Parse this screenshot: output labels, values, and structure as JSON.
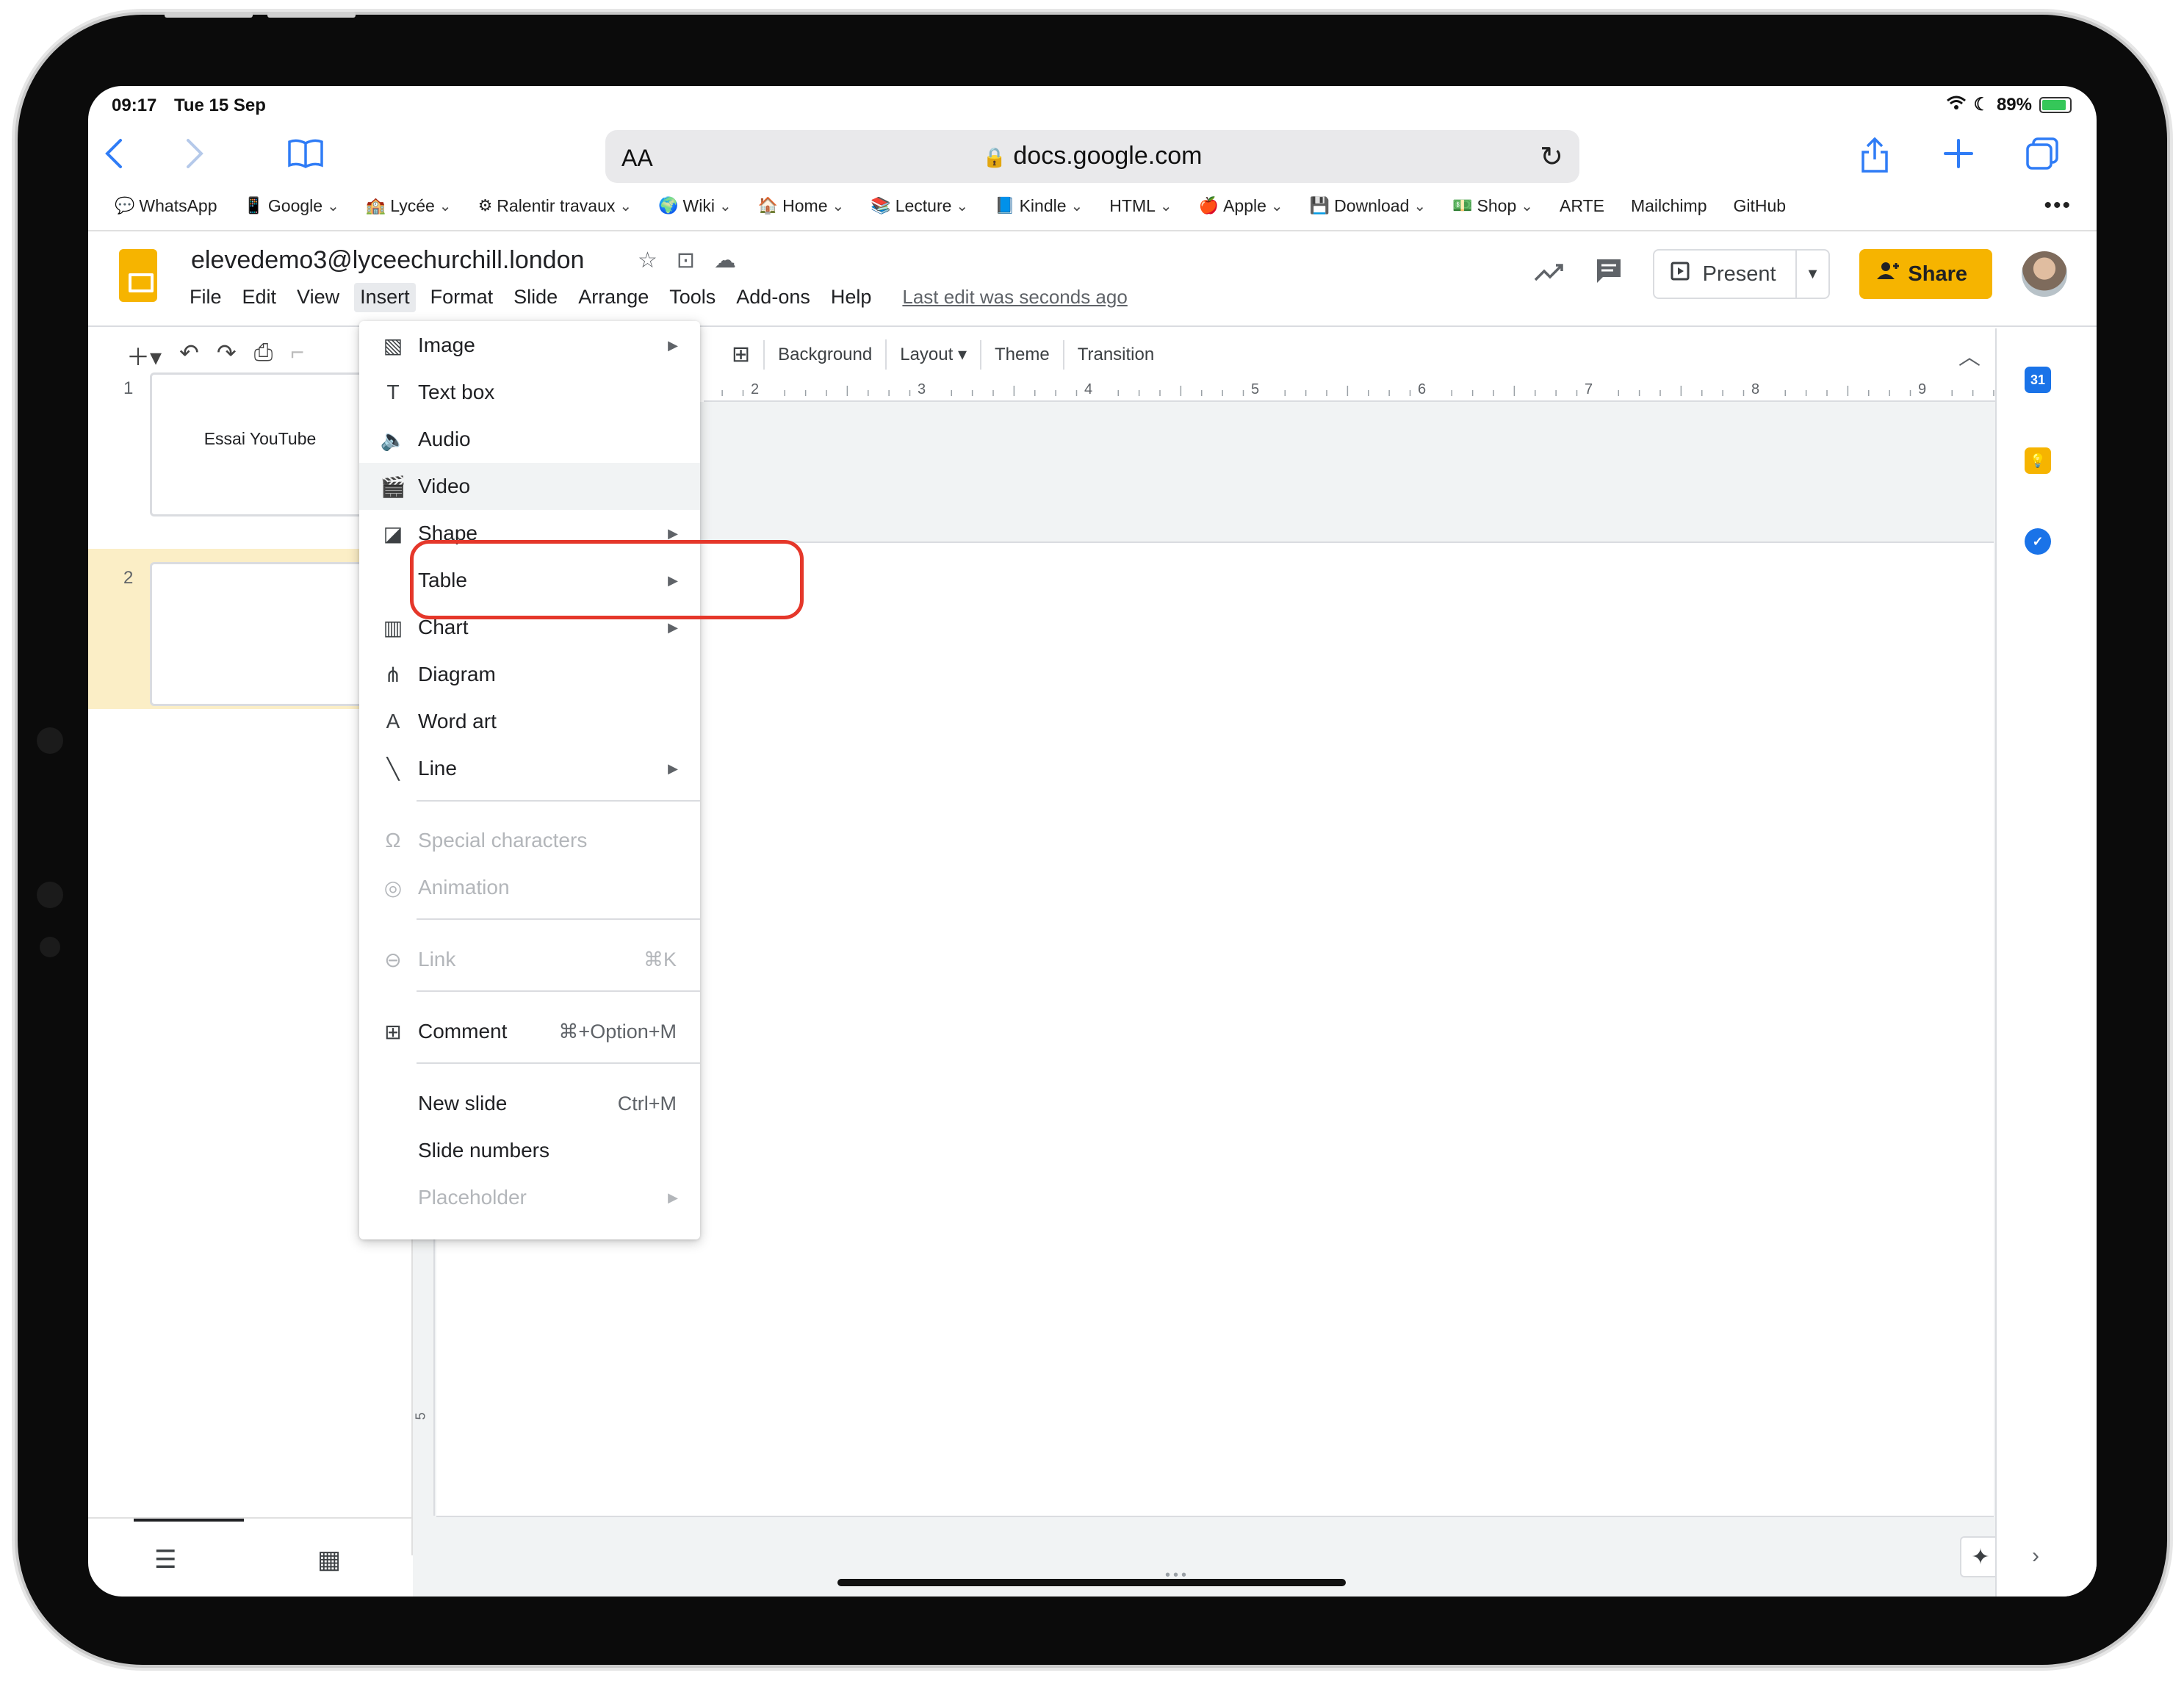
{
  "status_bar": {
    "time": "09:17",
    "date": "Tue 15 Sep",
    "battery": "89%",
    "battery_level": 0.89
  },
  "safari": {
    "text_size_label": "AA",
    "url": "docs.google.com",
    "icons": [
      "back-icon",
      "forward-icon",
      "bookmarks-book-icon",
      "lock-icon",
      "reload-icon",
      "share-icon",
      "new-tab-icon",
      "tabs-icon"
    ]
  },
  "bookmarks": [
    {
      "label": "WhatsApp",
      "icon": "💬",
      "has_menu": false
    },
    {
      "label": "Google",
      "icon": "📱",
      "has_menu": true
    },
    {
      "label": "Lycée",
      "icon": "🏫",
      "has_menu": true
    },
    {
      "label": "Ralentir travaux",
      "icon": "⚙",
      "has_menu": true
    },
    {
      "label": "Wiki",
      "icon": "🌍",
      "has_menu": true
    },
    {
      "label": "Home",
      "icon": "🏠",
      "has_menu": true
    },
    {
      "label": "Lecture",
      "icon": "📚",
      "has_menu": true
    },
    {
      "label": "Kindle",
      "icon": "📘",
      "has_menu": true
    },
    {
      "label": "HTML",
      "icon": "",
      "has_menu": true
    },
    {
      "label": "Apple",
      "icon": "🍎",
      "has_menu": true
    },
    {
      "label": "Download",
      "icon": "💾",
      "has_menu": true
    },
    {
      "label": "Shop",
      "icon": "💵",
      "has_menu": true
    },
    {
      "label": "ARTE",
      "icon": "",
      "has_menu": false
    },
    {
      "label": "Mailchimp",
      "icon": "",
      "has_menu": false
    },
    {
      "label": "GitHub",
      "icon": "",
      "has_menu": false
    }
  ],
  "doc": {
    "title": "elevedemo3@lyceechurchill.london",
    "menus": [
      "File",
      "Edit",
      "View",
      "Insert",
      "Format",
      "Slide",
      "Arrange",
      "Tools",
      "Add-ons",
      "Help"
    ],
    "active_menu": "Insert",
    "last_edit": "Last edit was seconds ago",
    "present_label": "Present",
    "share_label": "Share"
  },
  "toolbar": {
    "buttons": [
      "Background",
      "Layout ▾",
      "Theme",
      "Transition"
    ]
  },
  "ruler": {
    "labels": [
      "2",
      "3",
      "4",
      "5",
      "6",
      "7",
      "8",
      "9"
    ]
  },
  "vertical_ruler_label": "5",
  "slides": [
    {
      "number": "1",
      "text": "Essai YouTube"
    },
    {
      "number": "2",
      "text": ""
    }
  ],
  "insert_menu": {
    "items": [
      {
        "label": "Image",
        "icon": "▧",
        "submenu": true,
        "disabled": false,
        "shortcut": ""
      },
      {
        "label": "Text box",
        "icon": "T",
        "submenu": false,
        "disabled": false,
        "shortcut": ""
      },
      {
        "label": "Audio",
        "icon": "🔈",
        "submenu": false,
        "disabled": false,
        "shortcut": ""
      },
      {
        "label": "Video",
        "icon": "🎬",
        "submenu": false,
        "disabled": false,
        "shortcut": "",
        "highlighted": true
      },
      {
        "label": "Shape",
        "icon": "◪",
        "submenu": true,
        "disabled": false,
        "shortcut": ""
      },
      {
        "label": "Table",
        "icon": "",
        "submenu": true,
        "disabled": false,
        "shortcut": ""
      },
      {
        "label": "Chart",
        "icon": "▥",
        "submenu": true,
        "disabled": false,
        "shortcut": ""
      },
      {
        "label": "Diagram",
        "icon": "⋔",
        "submenu": false,
        "disabled": false,
        "shortcut": ""
      },
      {
        "label": "Word art",
        "icon": "A",
        "submenu": false,
        "disabled": false,
        "shortcut": ""
      },
      {
        "label": "Line",
        "icon": "╲",
        "submenu": true,
        "disabled": false,
        "shortcut": ""
      },
      {
        "label": "Special characters",
        "icon": "Ω",
        "submenu": false,
        "disabled": true,
        "shortcut": ""
      },
      {
        "label": "Animation",
        "icon": "◎",
        "submenu": false,
        "disabled": true,
        "shortcut": ""
      },
      {
        "label": "Link",
        "icon": "⊖",
        "submenu": false,
        "disabled": true,
        "shortcut": "⌘K"
      },
      {
        "label": "Comment",
        "icon": "⊞",
        "submenu": false,
        "disabled": false,
        "shortcut": "⌘+Option+M"
      },
      {
        "label": "New slide",
        "icon": "",
        "submenu": false,
        "disabled": false,
        "shortcut": "Ctrl+M"
      },
      {
        "label": "Slide numbers",
        "icon": "",
        "submenu": false,
        "disabled": false,
        "shortcut": ""
      },
      {
        "label": "Placeholder",
        "icon": "",
        "submenu": true,
        "disabled": true,
        "shortcut": ""
      }
    ]
  },
  "side_panel": [
    "calendar-icon",
    "keep-icon",
    "tasks-icon"
  ],
  "colors": {
    "accent_yellow": "#f6b400",
    "safari_blue": "#2f7cf6",
    "highlight_red": "#e5372a",
    "selected_slide_bg": "#fbeec6"
  }
}
